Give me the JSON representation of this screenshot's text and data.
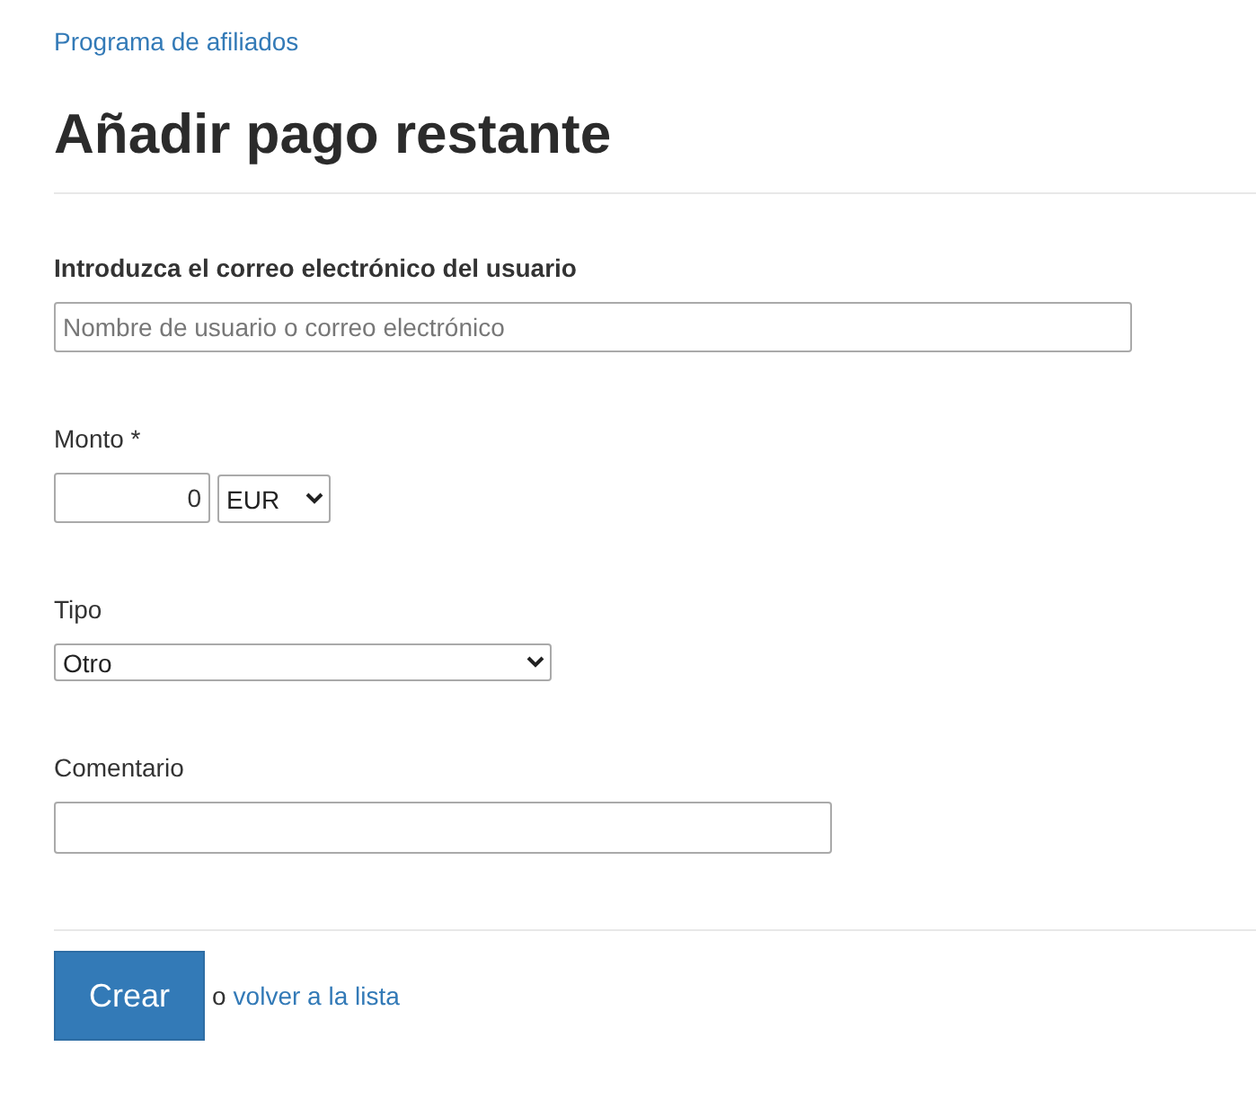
{
  "breadcrumb": "Programa de afiliados",
  "title": "Añadir pago restante",
  "fields": [
    {
      "kind": "text",
      "label": "Introduzca el correo electrónico del usuario",
      "label_bold": true,
      "placeholder": "Nombre de usuario o correo electrónico"
    },
    {
      "kind": "amount",
      "label": "Monto *",
      "label_bold": false,
      "value": "0",
      "currency": "EUR"
    },
    {
      "kind": "select",
      "label": "Tipo",
      "label_bold": false,
      "value": "Otro"
    },
    {
      "kind": "comment",
      "label": "Comentario",
      "label_bold": false
    }
  ],
  "footer": {
    "button": "Crear",
    "connector": "o",
    "link": "volver a la lista"
  }
}
